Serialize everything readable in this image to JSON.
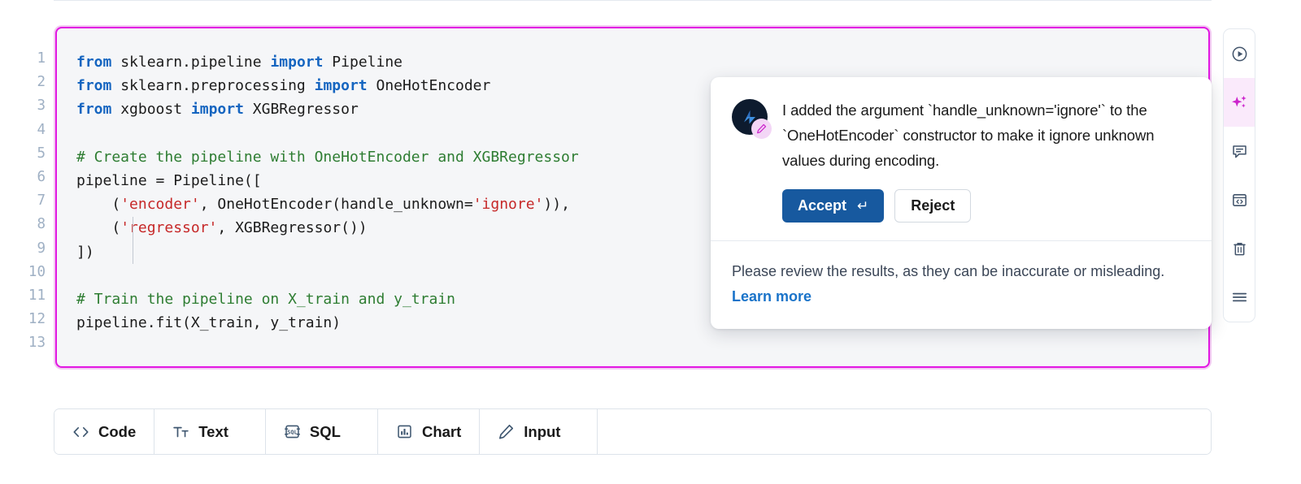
{
  "editor": {
    "line_numbers": [
      "1",
      "2",
      "3",
      "4",
      "5",
      "6",
      "7",
      "8",
      "9",
      "10",
      "11",
      "12",
      "13"
    ],
    "lines": [
      {
        "n": 1,
        "tokens": [
          {
            "t": "kw",
            "v": "from"
          },
          {
            "t": "plain",
            "v": " sklearn.pipeline "
          },
          {
            "t": "kw",
            "v": "import"
          },
          {
            "t": "plain",
            "v": " Pipeline"
          }
        ]
      },
      {
        "n": 2,
        "tokens": [
          {
            "t": "kw",
            "v": "from"
          },
          {
            "t": "plain",
            "v": " sklearn.preprocessing "
          },
          {
            "t": "kw",
            "v": "import"
          },
          {
            "t": "plain",
            "v": " OneHotEncoder"
          }
        ]
      },
      {
        "n": 3,
        "tokens": [
          {
            "t": "kw",
            "v": "from"
          },
          {
            "t": "plain",
            "v": " xgboost "
          },
          {
            "t": "kw",
            "v": "import"
          },
          {
            "t": "plain",
            "v": " XGBRegressor"
          }
        ]
      },
      {
        "n": 4,
        "tokens": []
      },
      {
        "n": 5,
        "tokens": [
          {
            "t": "cmt",
            "v": "# Create the pipeline with OneHotEncoder and XGBRegressor"
          }
        ]
      },
      {
        "n": 6,
        "tokens": [
          {
            "t": "plain",
            "v": "pipeline = Pipeline(["
          }
        ]
      },
      {
        "n": 7,
        "tokens": [
          {
            "t": "plain",
            "v": "    ("
          },
          {
            "t": "str",
            "v": "'encoder'"
          },
          {
            "t": "plain",
            "v": ", OneHotEncoder(handle_unknown="
          },
          {
            "t": "str",
            "v": "'ignore'"
          },
          {
            "t": "plain",
            "v": ")),"
          }
        ]
      },
      {
        "n": 8,
        "tokens": [
          {
            "t": "plain",
            "v": "    ("
          },
          {
            "t": "str",
            "v": "'regressor'"
          },
          {
            "t": "plain",
            "v": ", XGBRegressor())"
          }
        ]
      },
      {
        "n": 9,
        "tokens": [
          {
            "t": "plain",
            "v": "])"
          }
        ]
      },
      {
        "n": 10,
        "tokens": []
      },
      {
        "n": 11,
        "tokens": [
          {
            "t": "cmt",
            "v": "# Train the pipeline on X_train and y_train"
          }
        ]
      },
      {
        "n": 12,
        "tokens": [
          {
            "t": "plain",
            "v": "pipeline.fit(X_train, y_train)"
          }
        ]
      },
      {
        "n": 13,
        "tokens": []
      }
    ],
    "focus_border_color": "#e216e2",
    "background_color": "#f5f6f8"
  },
  "popup": {
    "avatar_icon": "assistant-avatar-icon",
    "badge_icon": "pencil-icon",
    "message": "I added the argument `handle_unknown='ignore'` to the `OneHotEncoder` constructor to make it ignore unknown values during encoding.",
    "accept_label": "Accept",
    "accept_shortcut_glyph": "↵",
    "reject_label": "Reject",
    "accept_color": "#17599f",
    "disclaimer": "Please review the results, as they can be inaccurate or misleading. ",
    "learn_more_label": "Learn more",
    "learn_more_color": "#1a73c9"
  },
  "rail": {
    "items": [
      {
        "name": "run-cell",
        "icon": "play-circle-icon",
        "active": false
      },
      {
        "name": "ai-assistant",
        "icon": "sparkles-icon",
        "active": true
      },
      {
        "name": "comment",
        "icon": "comment-icon",
        "active": false
      },
      {
        "name": "code-snippet",
        "icon": "code-window-icon",
        "active": false
      },
      {
        "name": "delete-cell",
        "icon": "trash-icon",
        "active": false
      },
      {
        "name": "more-options",
        "icon": "hamburger-icon",
        "active": false
      }
    ],
    "active_color": "#cc24cc",
    "active_background": "#faeafb"
  },
  "toolbar": {
    "buttons": [
      {
        "label": "Code",
        "icon": "angle-brackets-icon",
        "caret": false
      },
      {
        "label": "Text",
        "icon": "text-format-icon",
        "caret": true
      },
      {
        "label": "SQL",
        "icon": "sql-icon",
        "caret": true
      },
      {
        "label": "Chart",
        "icon": "bar-chart-icon",
        "caret": false
      },
      {
        "label": "Input",
        "icon": "pencil-icon",
        "caret": true
      }
    ]
  }
}
